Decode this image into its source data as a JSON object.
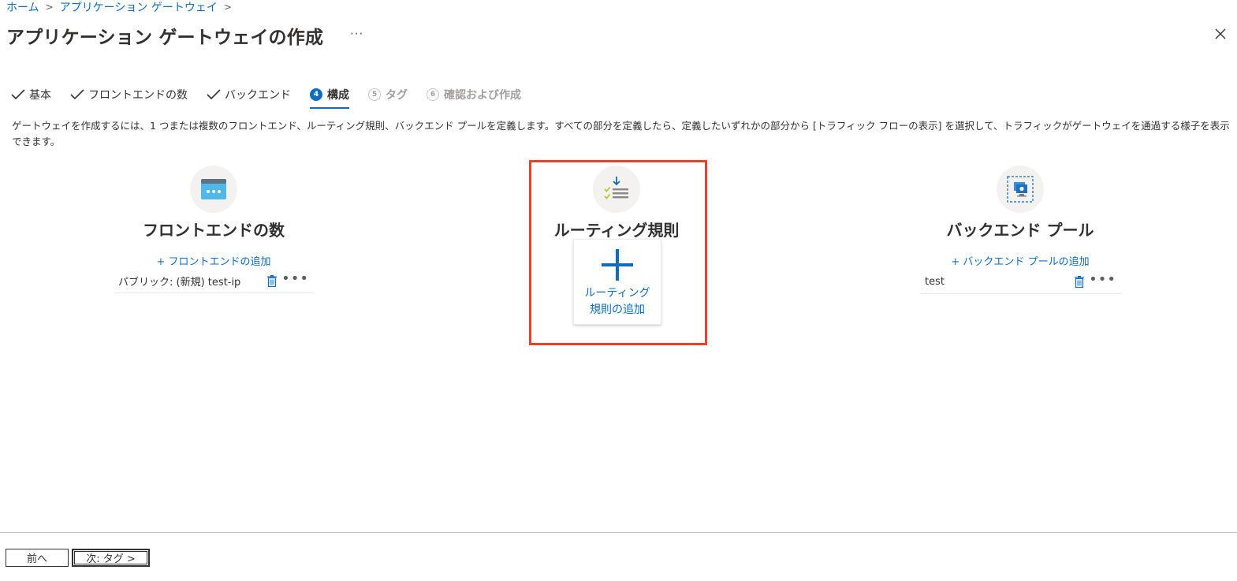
{
  "breadcrumb": {
    "home": "ホーム",
    "app_gateway": "アプリケーション ゲートウェイ",
    "sep": ">"
  },
  "page": {
    "title": "アプリケーション ゲートウェイの作成",
    "more": "···"
  },
  "tabs": [
    {
      "label": "基本",
      "state": "done"
    },
    {
      "label": "フロントエンドの数",
      "state": "done"
    },
    {
      "label": "バックエンド",
      "state": "done"
    },
    {
      "label": "構成",
      "step": "4",
      "state": "active"
    },
    {
      "label": "タグ",
      "step": "5",
      "state": "disabled"
    },
    {
      "label": "確認および作成",
      "step": "6",
      "state": "disabled"
    }
  ],
  "description": "ゲートウェイを作成するには、1 つまたは複数のフロントエンド、ルーティング規則、バックエンド プールを定義します。すべての部分を定義したら、定義したいずれかの部分から [トラフィック フローの表示] を選択して、トラフィックがゲートウェイを通過する様子を表示できます。",
  "frontend": {
    "title": "フロントエンドの数",
    "add_link": "+ フロントエンドの追加",
    "items": [
      "パブリック: (新規) test-ip"
    ]
  },
  "routing": {
    "title": "ルーティング規則",
    "add_label_line1": "ルーティング",
    "add_label_line2": "規則の追加"
  },
  "backend": {
    "title": "バックエンド プール",
    "add_link": "+ バックエンド プールの追加",
    "items": [
      "test"
    ]
  },
  "footer": {
    "prev": "前へ",
    "next": "次: タグ >"
  },
  "colors": {
    "accent": "#0f6cbd",
    "highlight": "#e8422d"
  }
}
